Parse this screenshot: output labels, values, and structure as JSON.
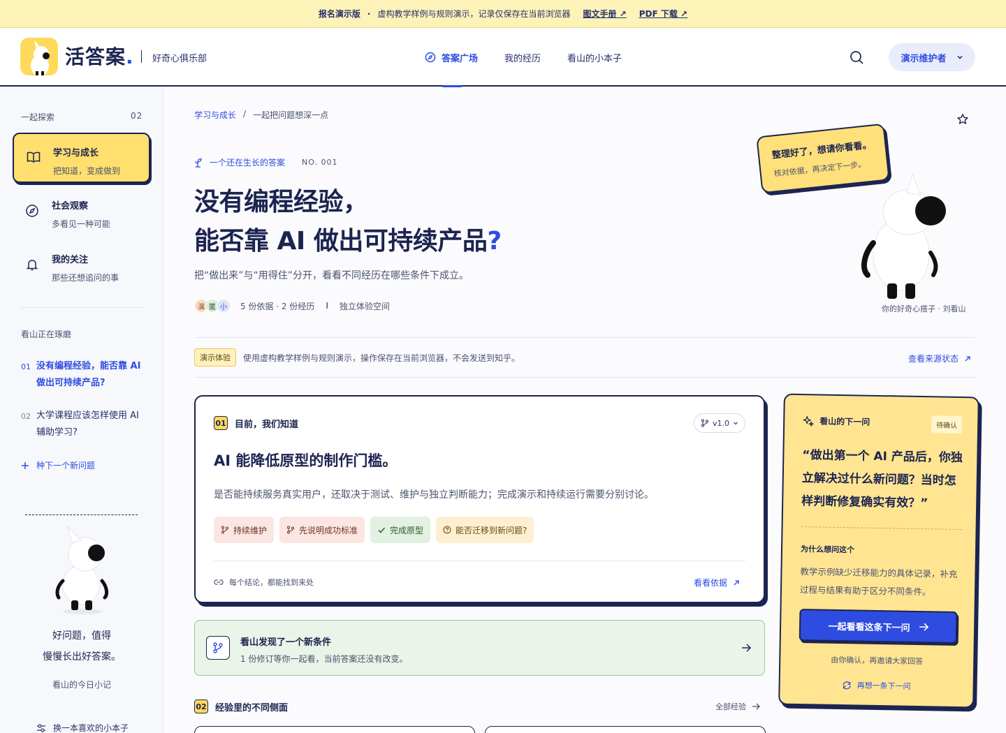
{
  "banner": {
    "label": "报名演示版",
    "sep": "·",
    "text": "虚构教学样例与规则演示，记录仅保存在当前浏览器",
    "link1": "图文手册 ↗",
    "link2": "PDF 下载 ↗"
  },
  "header": {
    "logo_text": "活答案",
    "logo_dot": ".",
    "club": "好奇心俱乐部",
    "nav": [
      {
        "label": "答案广场",
        "active": true
      },
      {
        "label": "我的经历"
      },
      {
        "label": "看山的小本子"
      }
    ],
    "user": "演示维护者"
  },
  "sidebar": {
    "section_label": "一起探索",
    "section_count": "02",
    "items": [
      {
        "title": "学习与成长",
        "sub": "把知道，变成做到"
      },
      {
        "title": "社会观察",
        "sub": "多看见一种可能"
      },
      {
        "title": "我的关注",
        "sub": "那些还想追问的事"
      }
    ],
    "pondering_label": "看山正在琢磨",
    "questions": [
      {
        "num": "01",
        "text": "没有编程经验，能否靠 AI 做出可持续产品?"
      },
      {
        "num": "02",
        "text": "大学课程应该怎样使用 AI 辅助学习?"
      }
    ],
    "add_question": "种下一个新问题",
    "tagline1": "好问题，值得",
    "tagline2": "慢慢长出好答案。",
    "note": "看山的今日小记",
    "bottom": "换一本喜欢的小本子"
  },
  "main": {
    "breadcrumb": {
      "parent": "学习与成长",
      "sep": "/",
      "current": "一起把问题想深一点"
    },
    "tagline": "一个还在生长的答案",
    "no": "NO. 001",
    "title_line1": "没有编程经验，",
    "title_line2": "能否靠 AI 做出可持续产品",
    "title_qm": "?",
    "subtitle": "把“做出来”与“用得住”分开，看看不同经历在哪些条件下成立。",
    "avatars": [
      {
        "char": "演",
        "bg": "#f6dcc8",
        "fg": "#8a4a22"
      },
      {
        "char": "匿",
        "bg": "#dbeedd",
        "fg": "#2c5a31"
      },
      {
        "char": "小",
        "bg": "#dfe5f7",
        "fg": "#2f4ce0"
      }
    ],
    "stats": "5 份依据 · 2 份经历",
    "bar": "I",
    "space": "独立体验空间",
    "bubble_line1": "整理好了，想请你看看。",
    "bubble_line2": "核对依据，再决定下一步。",
    "mascot_caption": "你的好奇心搭子 · 刘看山",
    "demo_badge": "演示体验",
    "demo_text": "使用虚构教学样例与规则演示，操作保存在当前浏览器，不会发送到知乎。",
    "source_link": "查看来源状态"
  },
  "answer_card": {
    "num": "01",
    "heading": "目前，我们知道",
    "version": "v1.0",
    "title": "AI 能降低原型的制作门槛。",
    "desc": "是否能持续服务真实用户，还取决于测试、维护与独立判断能力；完成演示和持续运行需要分别讨论。",
    "chips": [
      {
        "label": "持续维护",
        "tone": "red"
      },
      {
        "label": "先说明成功标准",
        "tone": "red"
      },
      {
        "label": "完成原型",
        "tone": "green"
      },
      {
        "label": "能否迁移到新问题?",
        "tone": "amber"
      }
    ],
    "foot": "每个结论，都能找到来处",
    "link": "看看依据"
  },
  "condition": {
    "title": "看山发现了一个新条件",
    "text": "1 份修订等你一起看，当前答案还没有改变。"
  },
  "section2": {
    "num": "02",
    "title": "经验里的不同侧面",
    "all": "全部经验"
  },
  "next_question": {
    "heading": "看山的下一问",
    "badge": "待确认",
    "quote": "“做出第一个 AI 产品后，你独立解决过什么新问题？当时怎样判断修复确实有效？”",
    "why_label": "为什么想问这个",
    "why_text": "教学示例缺少迁移能力的具体记录，补充过程与结果有助于区分不同条件。",
    "button": "一起看看这条下一问",
    "note": "由你确认，再邀请大家回答",
    "again": "再想一条下一问"
  },
  "colors": {
    "accent": "#2f4ce0",
    "ink": "#1c2450",
    "yellow": "#ffd95a"
  }
}
